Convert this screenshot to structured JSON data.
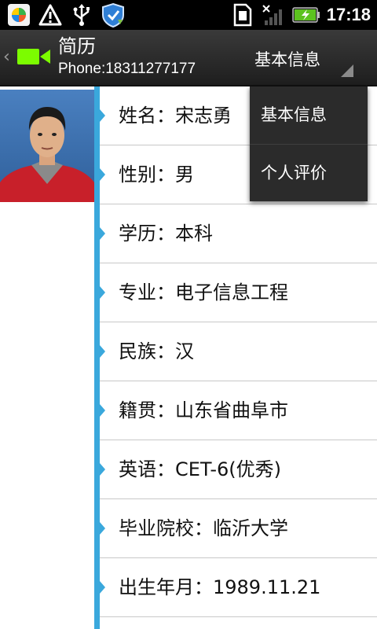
{
  "status_bar": {
    "time": "17:18",
    "icons": [
      "app-store-icon",
      "warning-icon",
      "usb-icon",
      "shield-icon",
      "sim-icon",
      "signal-icon",
      "battery-charging-icon"
    ]
  },
  "header": {
    "title": "简历",
    "subtitle": "Phone:18311277177",
    "spinner_value": "基本信息",
    "icons": [
      "back-chevron-icon",
      "video-camera-icon"
    ]
  },
  "colors": {
    "accent": "#3aa8dc",
    "video_icon": "#7cfc00",
    "titlebar": "#2a2a2a"
  },
  "dropdown": {
    "options": [
      "基本信息",
      "个人评价"
    ]
  },
  "resume_rows": [
    "姓名：宋志勇",
    "性别：男",
    "学历：本科",
    "专业：电子信息工程",
    "民族：汉",
    "籍贯：山东省曲阜市",
    "英语：CET-6(优秀)",
    "毕业院校：临沂大学",
    "出生年月：1989.11.21"
  ]
}
